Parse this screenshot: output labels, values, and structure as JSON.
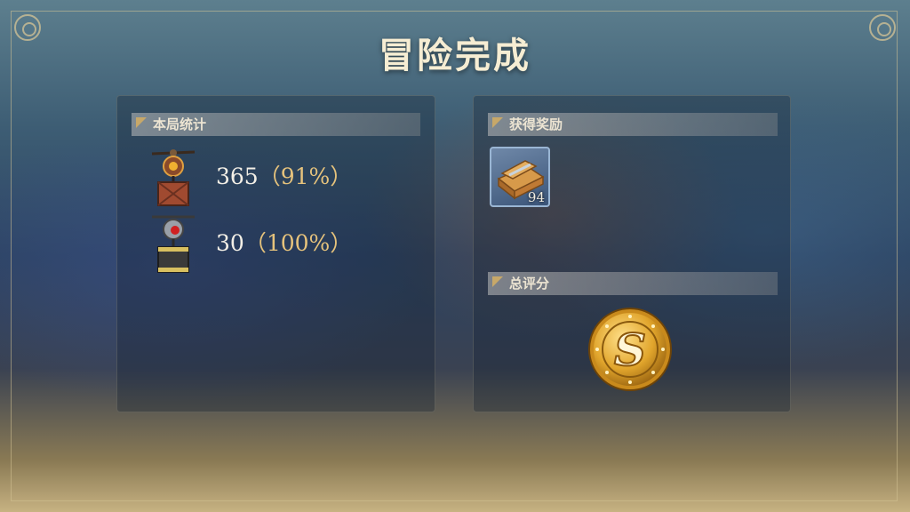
{
  "title": "冒险完成",
  "stats_panel": {
    "header": "本局统计",
    "rows": [
      {
        "icon": "orange-crate-drone-icon",
        "count": "365",
        "percent": "（91%）"
      },
      {
        "icon": "dark-crate-drone-icon",
        "count": "30",
        "percent": "（100%）"
      }
    ]
  },
  "rewards_panel": {
    "header": "获得奖励",
    "items": [
      {
        "icon": "wooden-crate-icon",
        "count": "94"
      }
    ]
  },
  "rating_panel": {
    "header": "总评分",
    "grade": "S"
  },
  "colors": {
    "accent_gold": "#e6c37c",
    "title_text": "#f6edd3",
    "header_triangle": "#c7a869"
  }
}
